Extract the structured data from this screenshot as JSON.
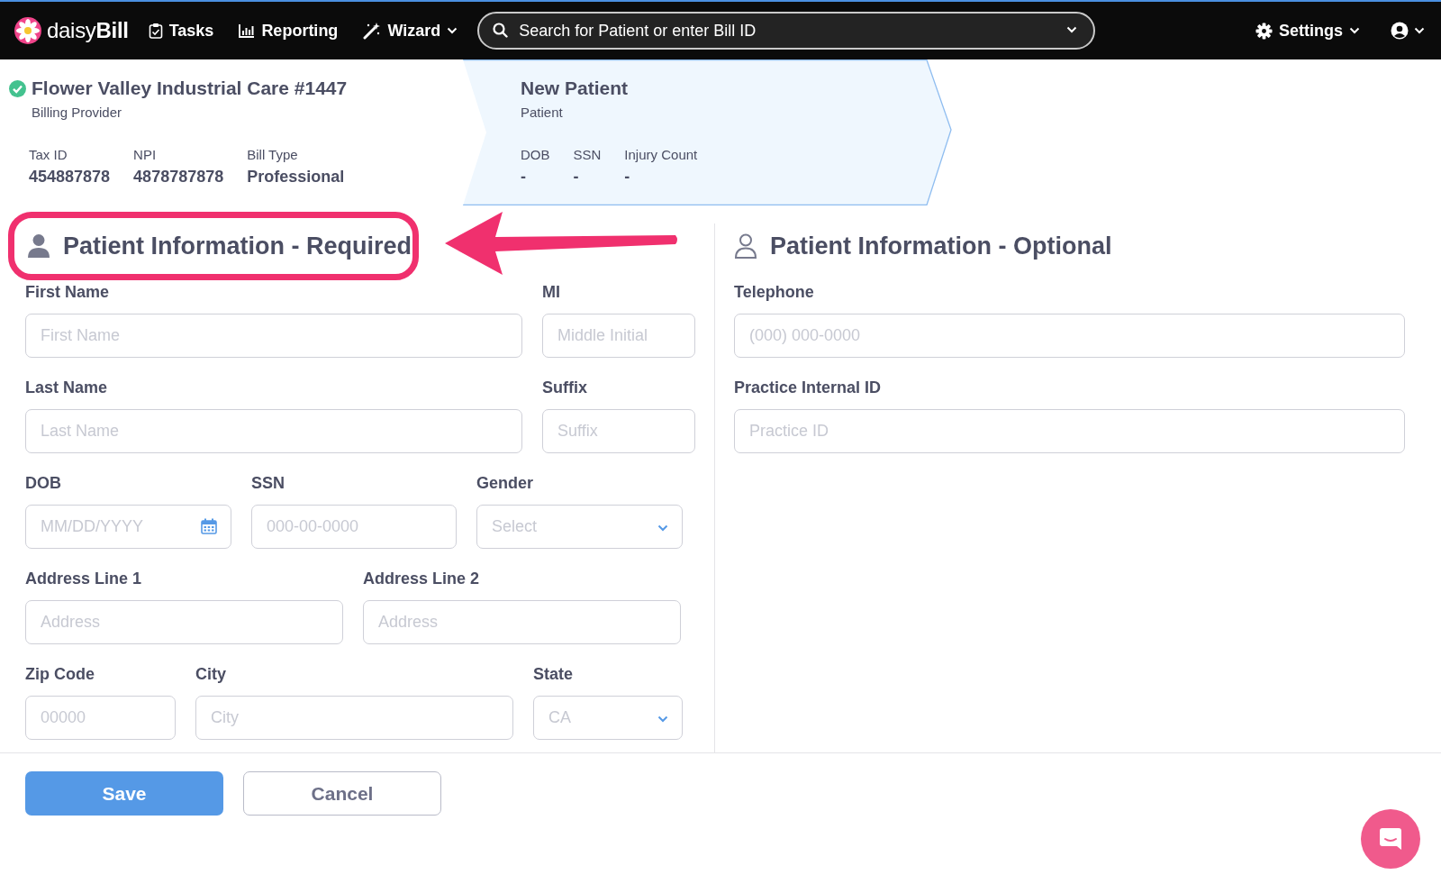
{
  "nav": {
    "brand": "daisy**Bill**",
    "items": [
      {
        "label": "Tasks",
        "kind": "tasks",
        "caret": false
      },
      {
        "label": "Reporting",
        "kind": "reporting",
        "caret": false
      },
      {
        "label": "Wizard",
        "kind": "wizard",
        "caret": true
      }
    ],
    "search": {
      "placeholder": "Search for Patient or enter Bill ID"
    },
    "settings": {
      "label": "Settings"
    }
  },
  "header": {
    "provider": {
      "name": "Flower Valley Industrial Care #1447",
      "subtitle": "Billing Provider",
      "verified": true,
      "fields": [
        {
          "label": "Tax ID",
          "value": "454887878"
        },
        {
          "label": "NPI",
          "value": "4878787878"
        },
        {
          "label": "Bill Type",
          "value": "Professional"
        }
      ]
    },
    "patient": {
      "name": "New Patient",
      "subtitle": "Patient",
      "fields": [
        {
          "label": "DOB",
          "value": "-"
        },
        {
          "label": "SSN",
          "value": "-"
        },
        {
          "label": "Injury Count",
          "value": "-"
        }
      ]
    }
  },
  "required": {
    "title": "Patient Information - Required",
    "highlighted": true,
    "rows": [
      [
        {
          "label": "First Name",
          "placeholder": "First Name",
          "kind": "text"
        },
        {
          "label": "MI",
          "placeholder": "Middle Initial",
          "kind": "text"
        }
      ],
      [
        {
          "label": "Last Name",
          "placeholder": "Last Name",
          "kind": "text"
        },
        {
          "label": "Suffix",
          "placeholder": "Suffix",
          "kind": "text"
        }
      ],
      [
        {
          "label": "DOB",
          "placeholder": "MM/DD/YYYY",
          "kind": "date"
        },
        {
          "label": "SSN",
          "placeholder": "000-00-0000",
          "kind": "text"
        },
        {
          "label": "Gender",
          "placeholder": "Select",
          "kind": "select"
        }
      ],
      [
        {
          "label": "Address Line 1",
          "placeholder": "Address",
          "kind": "text"
        },
        {
          "label": "Address Line 2",
          "placeholder": "Address",
          "kind": "text"
        }
      ],
      [
        {
          "label": "Zip Code",
          "placeholder": "00000",
          "kind": "text"
        },
        {
          "label": "City",
          "placeholder": "City",
          "kind": "text"
        },
        {
          "label": "State",
          "placeholder": "CA",
          "kind": "select"
        }
      ]
    ]
  },
  "optional": {
    "title": "Patient Information - Optional",
    "rows": [
      [
        {
          "label": "Telephone",
          "placeholder": "(000) 000-0000",
          "kind": "text"
        }
      ],
      [
        {
          "label": "Practice Internal ID",
          "placeholder": "Practice ID",
          "kind": "text"
        }
      ]
    ]
  },
  "buttons": [
    {
      "label": "Save",
      "kind": "primary"
    },
    {
      "label": "Cancel",
      "kind": "secondary"
    }
  ]
}
